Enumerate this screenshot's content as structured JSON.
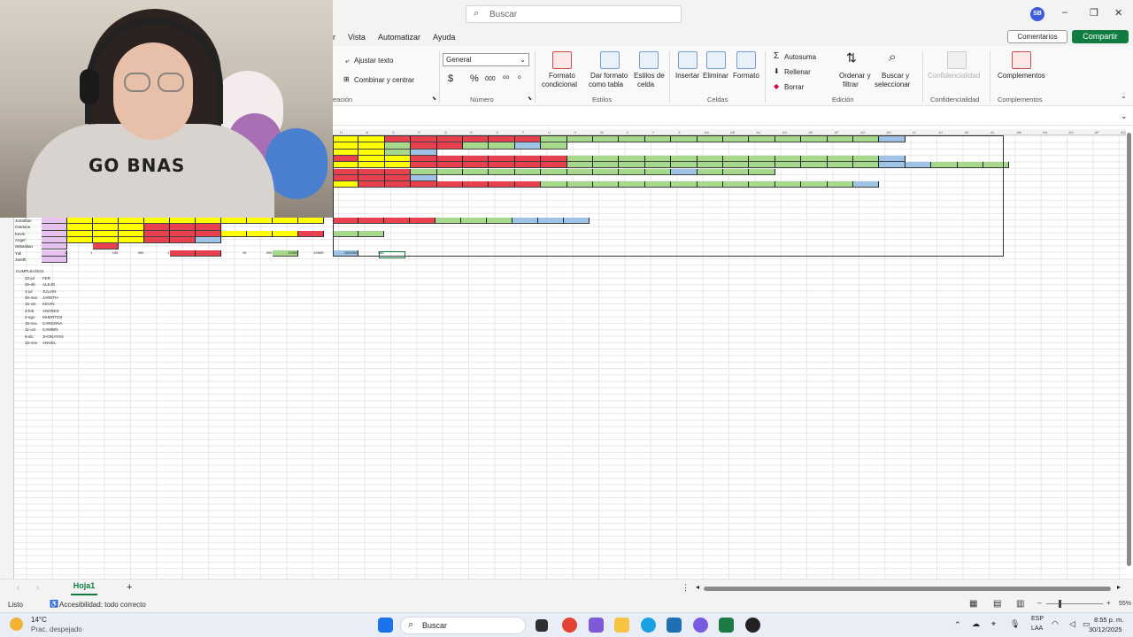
{
  "titlebar": {
    "search_placeholder": "Buscar",
    "avatar_initials": "SB",
    "min": "–",
    "restore": "❐",
    "close": "✕"
  },
  "menu": {
    "partial": "r",
    "items": [
      "Vista",
      "Automatizar",
      "Ayuda"
    ],
    "comments": "Comentarios",
    "share": "Compartir"
  },
  "ribbon": {
    "alignment": {
      "wrap_text": "Ajustar texto",
      "merge_center": "Combinar y centrar",
      "label_partial": "eación"
    },
    "number": {
      "format_value": "General",
      "label": "Número",
      "currency": "$",
      "percent": "%",
      "thousands": "000"
    },
    "styles": {
      "conditional": [
        "Formato",
        "condicional"
      ],
      "table": [
        "Dar formato",
        "como tabla"
      ],
      "cell_styles": [
        "Estilos de",
        "celda"
      ],
      "label": "Estilos"
    },
    "cells": {
      "insert": "Insertar",
      "delete": "Eliminar",
      "format": "Formato",
      "label": "Celdas"
    },
    "editing": {
      "autosum": "Autosuma",
      "fill": "Rellenar",
      "clear": "Borrar",
      "sort": [
        "Ordenar y",
        "filtrar"
      ],
      "find": [
        "Buscar y",
        "seleccionar"
      ],
      "label": "Edición"
    },
    "sensitivity": {
      "button": "Confidencialidad",
      "label": "Confidencialidad"
    },
    "addins": {
      "button": "Complementos",
      "label": "Complementos"
    }
  },
  "grid": {
    "column_headers": [
      "H",
      "N",
      "O",
      "P",
      "Q",
      "R",
      "S",
      "T",
      "U",
      "V",
      "W",
      "X",
      "Y",
      "Z",
      "AA",
      "AB",
      "AC",
      "AD",
      "AE",
      "AF",
      "AG",
      "AH",
      "AI",
      "AJ",
      "AK",
      "AL",
      "AM",
      "AN",
      "AO",
      "AP",
      "AQ"
    ],
    "names": [
      "Jonathan",
      "Cardona",
      "Kevin",
      "Angel",
      "Sebastian",
      "Yuli",
      "Jareth"
    ],
    "totals_row": [
      "1",
      "1",
      "100",
      "200",
      "1",
      "10",
      "200",
      "10000",
      "10000",
      "1000000",
      "100"
    ],
    "birthdays_title": "CUMPLEAÑOS",
    "birthdays": [
      [
        "23-jul",
        "FER"
      ],
      [
        "20-dic",
        "ALEJO"
      ],
      [
        "1-jul",
        "JULIAN"
      ],
      [
        "26-mar",
        "JARETH"
      ],
      [
        "15-oct",
        "KEVIN"
      ],
      [
        "3-feb",
        "ANDRES"
      ],
      [
        "2-ago",
        "MUERTOS"
      ],
      [
        "15-nov",
        "CARDONA"
      ],
      [
        "11-oct",
        "CAMBIÑ"
      ],
      [
        "9-dic",
        "JHONATAN"
      ],
      [
        "15-mar",
        "ANGEL"
      ]
    ]
  },
  "sheets": {
    "active": "Hoja1",
    "add": "+"
  },
  "status": {
    "ready": "Listo",
    "accessibility": "Accesibilidad: todo correcto",
    "zoom": "55%"
  },
  "taskbar": {
    "weather_temp": "14°C",
    "weather_desc": "Prac. despejado",
    "search": "Buscar",
    "lang": "ESP",
    "lang2": "LAA",
    "time": "8:55 p. m.",
    "date": "30/12/2025"
  }
}
